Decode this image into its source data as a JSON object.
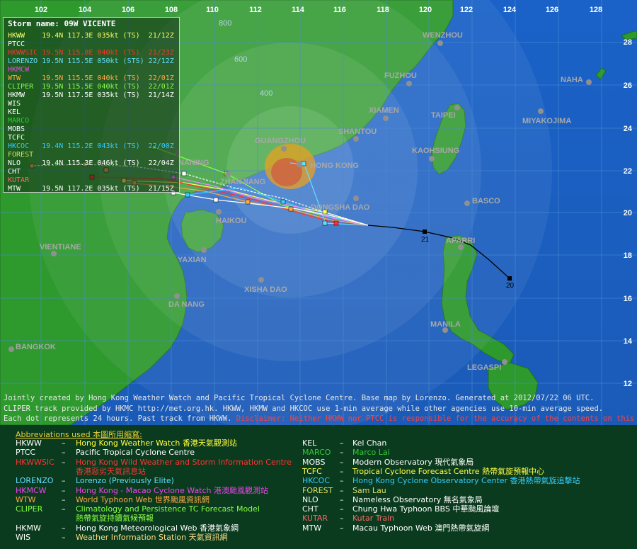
{
  "storm": {
    "title": "Storm name: 09W VICENTE",
    "entries": [
      {
        "text": "HKWW    19.4N 117.3E 035kt (TS)  21/12Z",
        "color": "#ffff66"
      },
      {
        "text": "PTCC",
        "color": "#ffffff"
      },
      {
        "text": "HKWWSIC 19.5N 115.8E 040kt (TS)  21/23Z",
        "color": "#ff3333"
      },
      {
        "text": "LORENZO 19.5N 115.5E 050kt (STS) 22/12Z",
        "color": "#66ddff"
      },
      {
        "text": "HKMCW",
        "color": "#ee44ee"
      },
      {
        "text": "WTW     19.5N 115.5E 040kt (TS)  22/01Z",
        "color": "#ffaa44"
      },
      {
        "text": "CLIPER  19.5N 115.5E 040kt (TS)  22/01Z",
        "color": "#88ff44"
      },
      {
        "text": "HKMW    19.5N 117.5E 035kt (TS)  21/14Z",
        "color": "#ffffff"
      },
      {
        "text": "WIS",
        "color": "#ffffff"
      },
      {
        "text": "KEL",
        "color": "#ffffff"
      },
      {
        "text": "MARCO",
        "color": "#33cc33"
      },
      {
        "text": "MOBS",
        "color": "#ffffff"
      },
      {
        "text": "TCFC",
        "color": "#ffffff"
      },
      {
        "text": "HKCOC   19.4N 115.2E 043kt (TS)  22/00Z",
        "color": "#33ccff"
      },
      {
        "text": "FOREST",
        "color": "#dddd66"
      },
      {
        "text": "NLO     19.4N 115.3E 046kt (TS)  22/04Z",
        "color": "#ffffff"
      },
      {
        "text": "CHT",
        "color": "#ffffff"
      },
      {
        "text": "KUTAR",
        "color": "#ff6666"
      },
      {
        "text": "MTW     19.5N 117.2E 035kt (TS)  21/15Z",
        "color": "#ffffff"
      }
    ]
  },
  "map": {
    "lon_labels": [
      "102",
      "104",
      "106",
      "108",
      "110",
      "112",
      "114",
      "116",
      "118",
      "120",
      "122",
      "124",
      "126",
      "128"
    ],
    "lat_labels": [
      "28",
      "26",
      "24",
      "22",
      "20",
      "18",
      "16",
      "14",
      "12"
    ],
    "range_labels": [
      "800",
      "600",
      "400"
    ],
    "places": [
      "WENZHOU",
      "FUZHOU",
      "NAHA",
      "XIAMEN",
      "TAIPEI",
      "MIYAKOJIMA",
      "GUANGZHOU",
      "SHANTOU",
      "KAOHSIUNG",
      "NANING",
      "HONG KONG",
      "ZHANJIANG",
      "DONGSHA DAO",
      "BASCO",
      "HAIKOU",
      "VIENTIANE",
      "YAXIAN",
      "APARRI",
      "XISHA DAO",
      "DA NANG",
      "MANILA",
      "BANGKOK",
      "LEGASPI"
    ],
    "track_labels": [
      "21",
      "20"
    ]
  },
  "credits": {
    "line1": "Jointly created by Hong Kong Weather Watch and Pacific Tropical Cyclone Centre. Base map by Lorenzo. Generated at 2012/07/22 06 UTC.",
    "line2": "CLIPER track provided by HKMC http://met.org.hk. HKWW, HKMW and HKCOC use 1-min average while other agencies use 10-min average speed.",
    "line3a": "Each dot represents 24 hours. Past track from HKWW.",
    "line3b": "Disclaimer: Neither HKWW nor PTCC is responsible for the accuracy of the contents on this map."
  },
  "legend": {
    "title": "Abbreviations used 本圖所用縮寫:",
    "dash": "–",
    "left": [
      {
        "abbr": "HKWW",
        "name": "Hong Kong Weather Watch 香港天氣觀測站",
        "color": "#ffff44",
        "abbr_color": "#ffffff"
      },
      {
        "abbr": "PTCC",
        "name": "Pacific Tropical Cyclone Centre",
        "color": "#ffffff",
        "abbr_color": "#ffffff"
      },
      {
        "abbr": "HKWWSIC",
        "name": "Hong Kong Wild Weather and Storm Information Centre",
        "name2": "香港惡劣天氣訊息站",
        "color": "#ff3333",
        "abbr_color": "#ff3333"
      },
      {
        "abbr": "LORENZO",
        "name": "Lorenzo (Previously Elite)",
        "color": "#66ddff",
        "abbr_color": "#66ddff"
      },
      {
        "abbr": "HKMCW",
        "name": "Hong Kong - Macao Cyclone Watch 港澳颱風觀測站",
        "color": "#ee44ee",
        "abbr_color": "#ee44ee"
      },
      {
        "abbr": "WTW",
        "name": "World Typhoon Web 世界颱風資訊網",
        "color": "#ffaa44",
        "abbr_color": "#ffaa44"
      },
      {
        "abbr": "CLIPER",
        "name": "Climatology and Persistence TC Forecast Model",
        "name2": "熱帶氣旋持續氣候預報",
        "color": "#88ff44",
        "abbr_color": "#88ff44"
      },
      {
        "abbr": "HKMW",
        "name": "Hong Kong Meteorological Web 香港氣象網",
        "color": "#ffffff",
        "abbr_color": "#ffffff"
      },
      {
        "abbr": "WIS",
        "name": "Weather Information Station 天氣資訊網",
        "color": "#ffdd88",
        "abbr_color": "#ffffff"
      }
    ],
    "right": [
      {
        "abbr": "KEL",
        "name": "Kel Chan",
        "color": "#ffffff",
        "abbr_color": "#ffffff"
      },
      {
        "abbr": "MARCO",
        "name": "Marco Lai",
        "color": "#33cc33",
        "abbr_color": "#33cc33"
      },
      {
        "abbr": "MOBS",
        "name": "Modern Observatory 現代氣象局",
        "color": "#ffffff",
        "abbr_color": "#ffffff"
      },
      {
        "abbr": "TCFC",
        "name": "Tropical Cyclone Forecast Centre 熱帶氣旋預報中心",
        "color": "#ffff44",
        "abbr_color": "#ffff44"
      },
      {
        "abbr": "HKCOC",
        "name": "Hong Kong Cyclone Observatory Center 香港熱帶氣旋追擊站",
        "color": "#33ccff",
        "abbr_color": "#33ccff"
      },
      {
        "abbr": "FOREST",
        "name": "Sam Lau",
        "color": "#dddd66",
        "abbr_color": "#dddd66"
      },
      {
        "abbr": "NLO",
        "name": "Nameless Observatory 無名氣象局",
        "color": "#ffffff",
        "abbr_color": "#ffffff"
      },
      {
        "abbr": "CHT",
        "name": "Chung Hwa Typhoon BBS 中華颱風論壇",
        "color": "#ffffff",
        "abbr_color": "#ffffff"
      },
      {
        "abbr": "KUTAR",
        "name": "Kutar Train",
        "color": "#ff6666",
        "abbr_color": "#ff6666"
      },
      {
        "abbr": "MTW",
        "name": "Macau Typhoon Web 澳門熱帶氣旋網",
        "color": "#ffffff",
        "abbr_color": "#ffffff"
      }
    ]
  }
}
